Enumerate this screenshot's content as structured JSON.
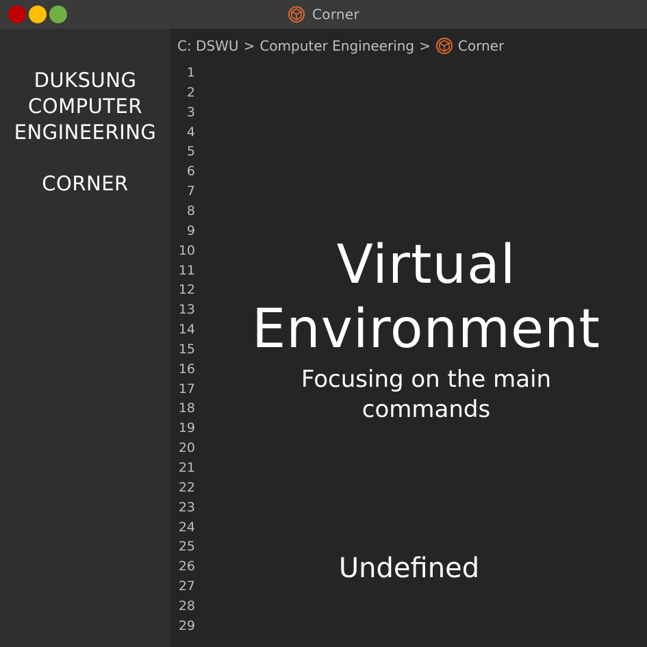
{
  "window": {
    "title": "Corner",
    "title_icon": "cube-icon",
    "controls": [
      "close",
      "minimize",
      "maximize"
    ],
    "colors": {
      "close": "#c00000",
      "minimize": "#ffbf00",
      "maximize": "#6fb043",
      "icon_accent": "#e06a2b"
    }
  },
  "sidebar": {
    "title": "DUKSUNG\nCOMPUTER\nENGINEERING",
    "subtitle": "CORNER"
  },
  "breadcrumb": {
    "items": [
      "C: DSWU",
      "Computer Engineering",
      "Corner"
    ],
    "separator": ">",
    "last_icon": "cube-icon"
  },
  "gutter": {
    "line_numbers": [
      "1",
      "2",
      "3",
      "4",
      "5",
      "6",
      "7",
      "8",
      "9",
      "10",
      "11",
      "12",
      "13",
      "14",
      "15",
      "16",
      "17",
      "18",
      "19",
      "20",
      "21",
      "22",
      "23",
      "24",
      "25",
      "26",
      "27",
      "28",
      "29"
    ]
  },
  "main": {
    "title": "Virtual\nEnvironment",
    "subtitle": "Focusing on the main\ncommands",
    "status": "Undefined"
  }
}
